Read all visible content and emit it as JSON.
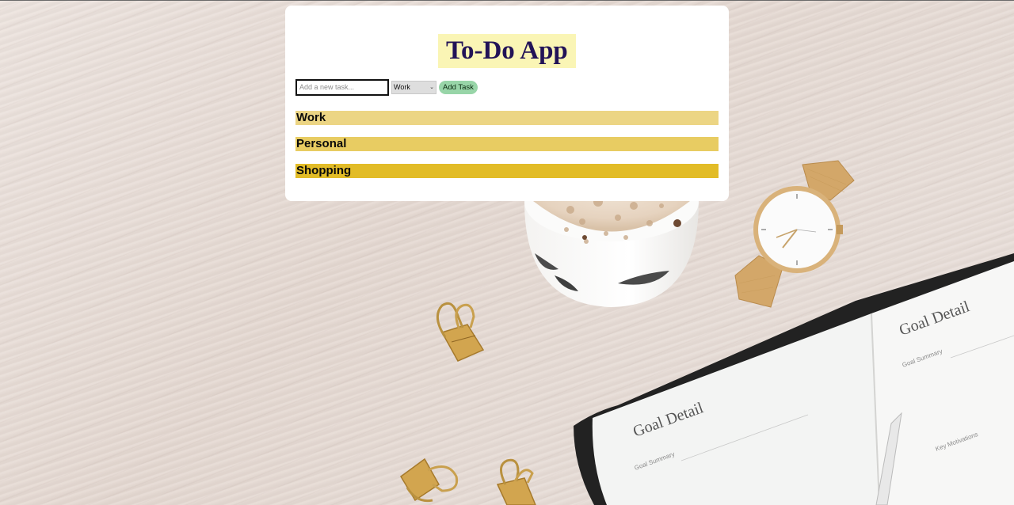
{
  "app": {
    "title": "To-Do App"
  },
  "form": {
    "task_placeholder": "Add a new task...",
    "task_value": "",
    "category_selected": "Work",
    "category_chevron": "⌄",
    "add_button_label": "Add Task"
  },
  "categories": [
    {
      "label": "Work",
      "color": "#ecd584"
    },
    {
      "label": "Personal",
      "color": "#e8cc62"
    },
    {
      "label": "Shopping",
      "color": "#e2bc27"
    }
  ],
  "colors": {
    "title_highlight": "#faf5b5",
    "title_text": "#221357",
    "add_button": "#98d5a8",
    "card": "#ffffff"
  }
}
